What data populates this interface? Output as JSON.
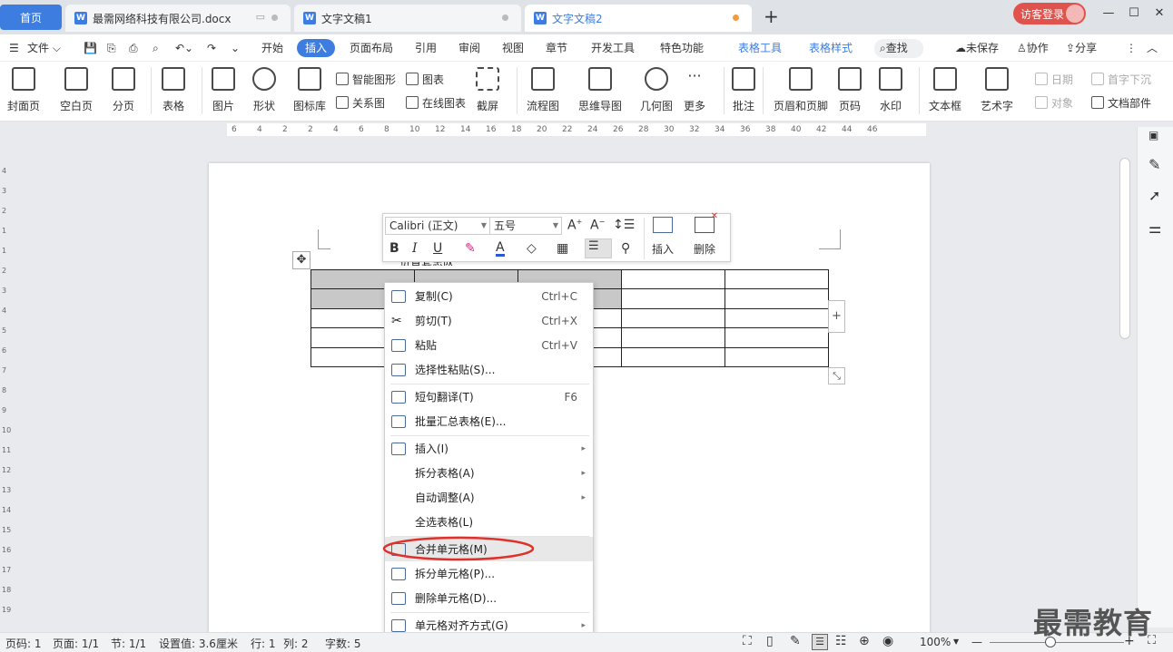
{
  "tabs": {
    "home": "首页",
    "doc1": "最需网络科技有限公司.docx",
    "doc2": "文字文稿1",
    "doc3": "文字文稿2",
    "add": "+",
    "visitor": "访客登录"
  },
  "menu": {
    "file": "文件",
    "items": [
      "开始",
      "插入",
      "页面布局",
      "引用",
      "审阅",
      "视图",
      "章节",
      "开发工具",
      "特色功能",
      "表格工具",
      "表格样式"
    ],
    "search": "查找",
    "unsaved": "未保存",
    "collab": "协作",
    "share": "分享"
  },
  "ribbon": {
    "cover": "封面页",
    "blank": "空白页",
    "pagebreak": "分页",
    "table": "表格",
    "picture": "图片",
    "shape": "形状",
    "iconlib": "图标库",
    "smartart": "智能图形",
    "chart": "图表",
    "relation": "关系图",
    "onlinechart": "在线图表",
    "screenshot": "截屏",
    "flowchart": "流程图",
    "mindmap": "思维导图",
    "geometry": "几何图",
    "more": "更多",
    "comment": "批注",
    "headerfooter": "页眉和页脚",
    "pagenum": "页码",
    "watermark": "水印",
    "textbox": "文本框",
    "wordart": "艺术字",
    "date": "日期",
    "dropcap": "首字下沉",
    "object": "对象",
    "docparts": "文档部件"
  },
  "ruler_ticks": [
    "6",
    "4",
    "2",
    "2",
    "4",
    "6",
    "8",
    "10",
    "12",
    "14",
    "16",
    "18",
    "20",
    "22",
    "24",
    "26",
    "28",
    "30",
    "32",
    "34",
    "36",
    "38",
    "40",
    "42",
    "44",
    "46"
  ],
  "vruler_ticks": [
    "4",
    "3",
    "2",
    "1",
    "1",
    "2",
    "3",
    "4",
    "5",
    "6",
    "7",
    "8",
    "9",
    "10",
    "11",
    "12",
    "13",
    "14",
    "15",
    "16",
    "17",
    "18",
    "19"
  ],
  "minitoolbar": {
    "font": "Calibri (正文)",
    "size": "五号",
    "insert": "插入",
    "delete": "删除"
  },
  "doc_text": "负直套忠队",
  "context_menu": [
    {
      "label": "复制(C)",
      "shortcut": "Ctrl+C"
    },
    {
      "label": "剪切(T)",
      "shortcut": "Ctrl+X"
    },
    {
      "label": "粘贴",
      "shortcut": "Ctrl+V"
    },
    {
      "label": "选择性粘贴(S)...",
      "shortcut": ""
    },
    {
      "label": "短句翻译(T)",
      "shortcut": "F6"
    },
    {
      "label": "批量汇总表格(E)...",
      "shortcut": ""
    },
    {
      "label": "插入(I)",
      "shortcut": ""
    },
    {
      "label": "拆分表格(A)",
      "shortcut": ""
    },
    {
      "label": "自动调整(A)",
      "shortcut": ""
    },
    {
      "label": "全选表格(L)",
      "shortcut": ""
    },
    {
      "label": "合并单元格(M)",
      "shortcut": ""
    },
    {
      "label": "拆分单元格(P)...",
      "shortcut": ""
    },
    {
      "label": "删除单元格(D)...",
      "shortcut": ""
    },
    {
      "label": "单元格对齐方式(G)",
      "shortcut": ""
    }
  ],
  "status": {
    "pagecode": "页码: 1",
    "page": "页面: 1/1",
    "section": "节: 1/1",
    "setting": "设置值: 3.6厘米",
    "row": "行: 1",
    "col": "列: 2",
    "words": "字数: 5",
    "zoom": "100%"
  },
  "watermark_text": "最需教育",
  "colors": {
    "accent": "#3d7de0",
    "highlight": "#e8e8e8",
    "annotation": "#e0302a"
  }
}
